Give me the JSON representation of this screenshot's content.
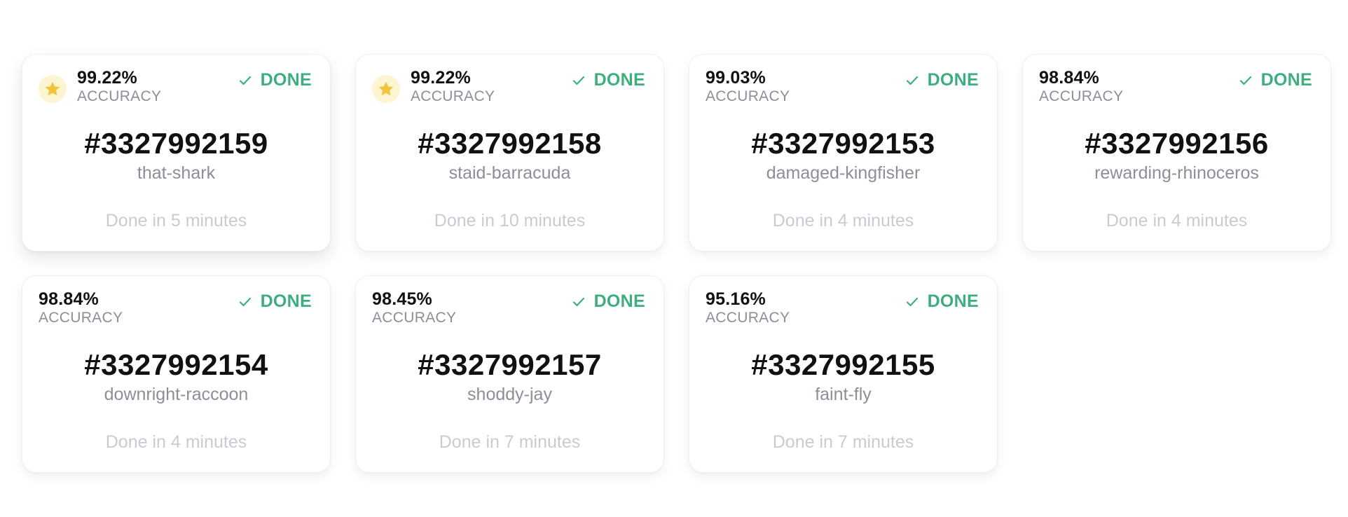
{
  "accuracy_label": "ACCURACY",
  "status_label": "DONE",
  "colors": {
    "status_done": "#3fae7e",
    "star": "#f0c53a",
    "star_bg": "#fdf4d2"
  },
  "icons": {
    "star": "star-icon",
    "check": "check-icon"
  },
  "cards": [
    {
      "starred": true,
      "accuracy": "99.22%",
      "id": "#3327992159",
      "name": "that-shark",
      "time": "Done in 5 minutes"
    },
    {
      "starred": true,
      "accuracy": "99.22%",
      "id": "#3327992158",
      "name": "staid-barracuda",
      "time": "Done in 10 minutes"
    },
    {
      "starred": false,
      "accuracy": "99.03%",
      "id": "#3327992153",
      "name": "damaged-kingfisher",
      "time": "Done in 4 minutes"
    },
    {
      "starred": false,
      "accuracy": "98.84%",
      "id": "#3327992156",
      "name": "rewarding-rhinoceros",
      "time": "Done in 4 minutes"
    },
    {
      "starred": false,
      "accuracy": "98.84%",
      "id": "#3327992154",
      "name": "downright-raccoon",
      "time": "Done in 4 minutes"
    },
    {
      "starred": false,
      "accuracy": "98.45%",
      "id": "#3327992157",
      "name": "shoddy-jay",
      "time": "Done in 7 minutes"
    },
    {
      "starred": false,
      "accuracy": "95.16%",
      "id": "#3327992155",
      "name": "faint-fly",
      "time": "Done in 7 minutes"
    }
  ]
}
